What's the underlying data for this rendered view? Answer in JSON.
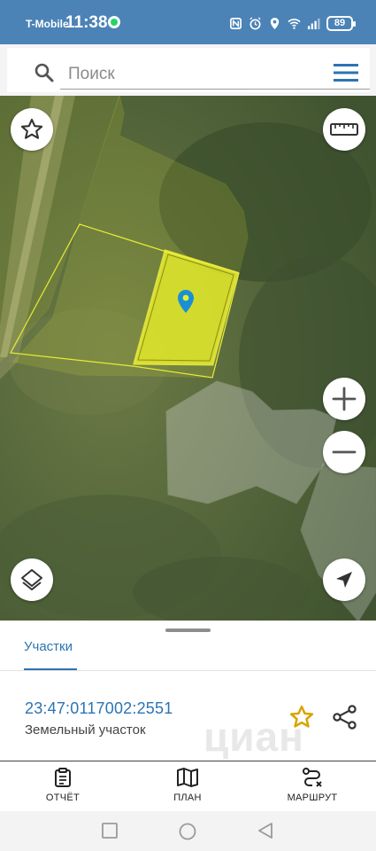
{
  "status_bar": {
    "carrier": "T-Mobile",
    "time": "11:38",
    "battery": "89",
    "icons": [
      "whatsapp-icon",
      "nfc-icon",
      "alarm-icon",
      "location-icon",
      "wifi-icon",
      "signal-icon",
      "battery-icon"
    ]
  },
  "search": {
    "placeholder": "Поиск",
    "value": ""
  },
  "map": {
    "controls": [
      "star-icon",
      "ruler-icon",
      "zoom-in-icon",
      "zoom-out-icon",
      "layers-icon",
      "navigation-arrow-icon"
    ],
    "selected_parcel_color": "#e7ee2a",
    "marker_color": "#1a8fd6"
  },
  "sheet": {
    "tab_label": "Участки",
    "parcel_id": "23:47:0117002:2551",
    "parcel_type": "Земельный участок",
    "watermark": "циан"
  },
  "actions": [
    {
      "label": "ОТЧЁТ",
      "icon": "clipboard-icon"
    },
    {
      "label": "ПЛАН",
      "icon": "map-icon"
    },
    {
      "label": "МАРШРУТ",
      "icon": "route-icon"
    }
  ],
  "colors": {
    "accent": "#2c74b2",
    "status_bar": "#4b83b7",
    "favorite_star": "#d9a400"
  }
}
